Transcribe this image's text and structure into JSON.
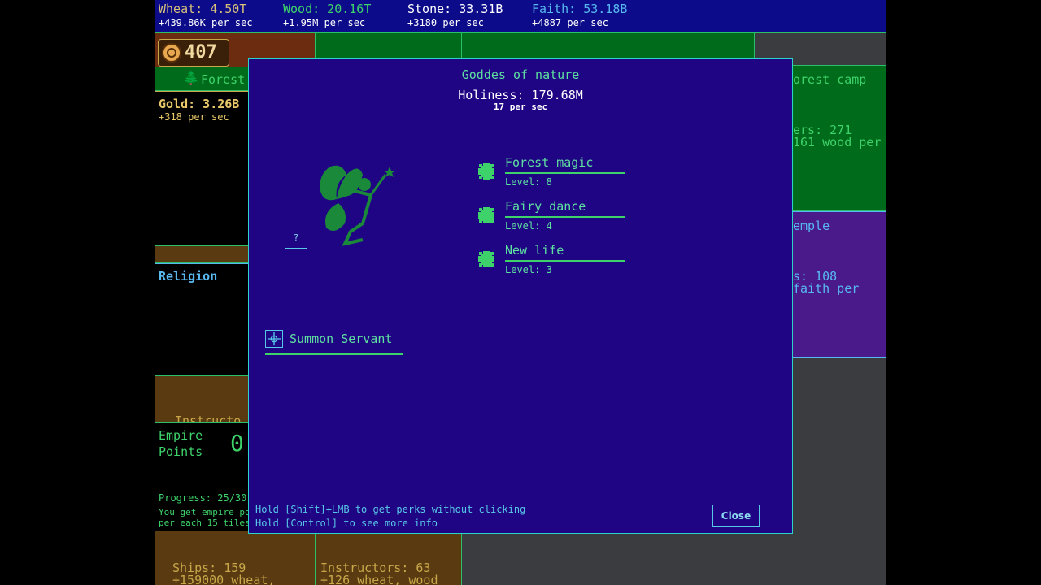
{
  "resources": [
    {
      "name": "Wheat: 4.50T",
      "rate": "+439.86K per sec",
      "color": "#d8c27a"
    },
    {
      "name": "Wood: 20.16T",
      "rate": "+1.95M per sec",
      "color": "#3ed36a"
    },
    {
      "name": "Stone: 33.31B",
      "rate": "+3180 per sec",
      "color": "#ffffff"
    },
    {
      "name": "Faith: 53.18B",
      "rate": "+4887 per sec",
      "color": "#58b8f0"
    }
  ],
  "counter": {
    "value": "407"
  },
  "tiles": {
    "forest_label": "Forest",
    "gold": {
      "name": "Gold: 3.26B",
      "rate": "+318 per sec"
    },
    "religion": "Religion",
    "empire": {
      "title1": "Empire",
      "title2": "Points",
      "value": "0",
      "progress": "Progress: 25/30",
      "desc1": "You get empire po",
      "desc2": "per each 15 tiles"
    },
    "instructor_partial": "Instructo",
    "forest_camp": {
      "title": "orest camp",
      "workers": "ers: 271",
      "rate": "161 wood per"
    },
    "temple": {
      "title": "emple",
      "workers": "s: 108",
      "rate": "faith per"
    },
    "ships": {
      "title": "Ships: 159",
      "rate": "+159000 wheat,"
    },
    "instructors": {
      "title": "Instructors: 63",
      "rate": "+126 wheat, wood"
    }
  },
  "modal": {
    "title": "Goddes of nature",
    "holiness": "Holiness: 179.68M",
    "holiness_rate": "17 per sec",
    "help_label": "?",
    "perks": [
      {
        "name": "Forest magic",
        "level": "Level: 8"
      },
      {
        "name": "Fairy dance",
        "level": "Level: 4"
      },
      {
        "name": "New life",
        "level": "Level: 3"
      }
    ],
    "summon_label": "Summon Servant",
    "hint1": "Hold [Shift]+LMB to get perks without clicking",
    "hint2": "Hold [Control] to see more info",
    "close_label": "Close"
  },
  "colors": {
    "modal_bg": "#1f0584",
    "accent_green": "#3ed36a",
    "text_green": "#5ee0a0",
    "cyan": "#58c8e8"
  }
}
